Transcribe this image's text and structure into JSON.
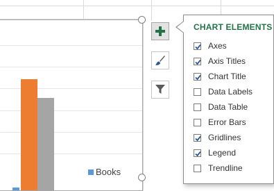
{
  "panel": {
    "title": "CHART ELEMENTS",
    "options": [
      {
        "label": "Axes",
        "checked": true
      },
      {
        "label": "Axis Titles",
        "checked": true
      },
      {
        "label": "Chart Title",
        "checked": true
      },
      {
        "label": "Data Labels",
        "checked": false
      },
      {
        "label": "Data Table",
        "checked": false
      },
      {
        "label": "Error Bars",
        "checked": false
      },
      {
        "label": "Gridlines",
        "checked": true
      },
      {
        "label": "Legend",
        "checked": true
      },
      {
        "label": "Trendline",
        "checked": false
      }
    ]
  },
  "side_buttons": {
    "elements": {
      "icon": "plus-icon",
      "active": true
    },
    "styles": {
      "icon": "paintbrush-icon"
    },
    "filters": {
      "icon": "filter-icon"
    }
  },
  "chart": {
    "legend_label": "Books"
  },
  "colors": {
    "accent_green": "#217346",
    "bar_orange": "#ed7d31",
    "bar_gray": "#a5a5a5",
    "bar_blue": "#5b9bd5",
    "check_blue": "#2b579a"
  }
}
